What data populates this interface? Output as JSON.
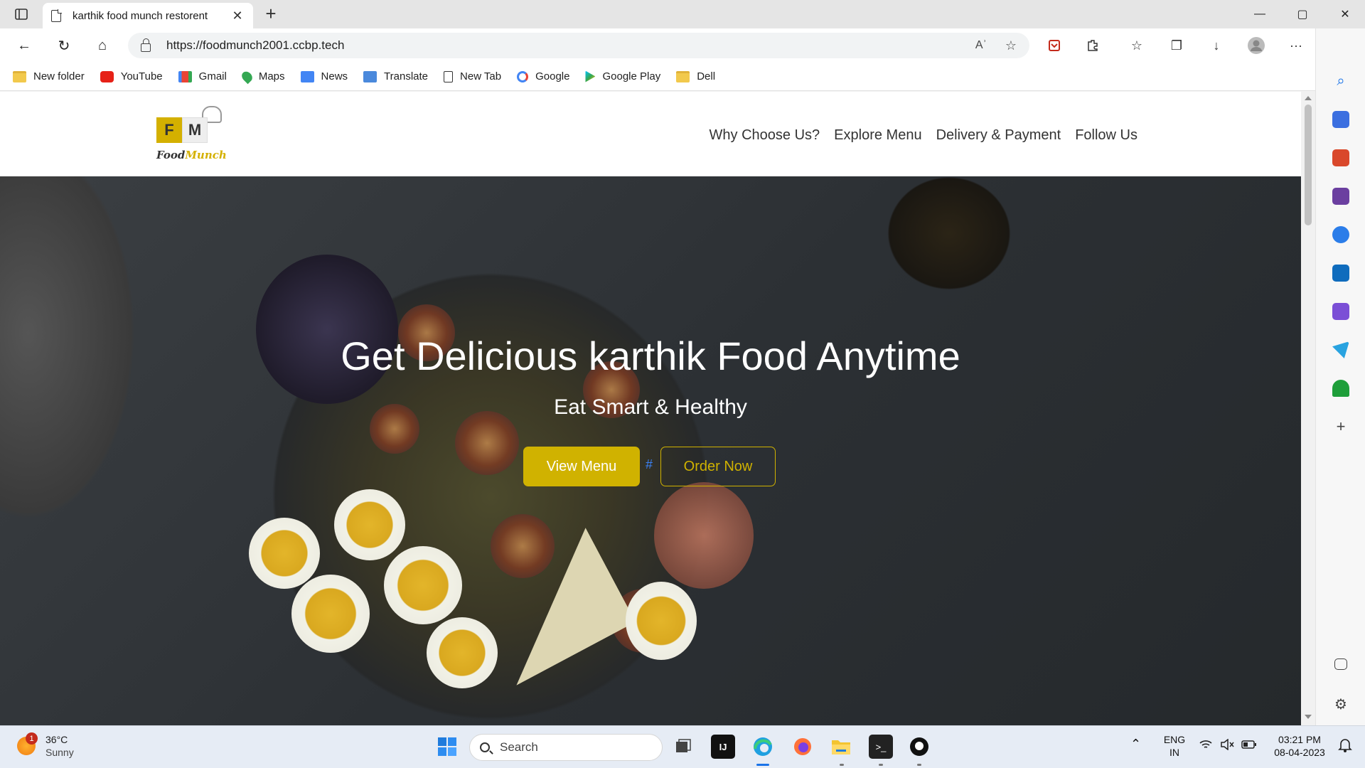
{
  "browser": {
    "tab": {
      "title": "karthik food munch restorent",
      "close": "✕"
    },
    "new_tab": "+",
    "window_controls": {
      "minimize": "—",
      "maximize": "▢",
      "close": "✕"
    },
    "address": {
      "url": "https://foodmunch2001.ccbp.tech",
      "read_aloud": "Aʾ",
      "favorite": "☆"
    },
    "nav": {
      "back": "←",
      "refresh": "↻",
      "home": "⌂"
    },
    "toolbar_icons": {
      "extensions": "⚙",
      "favorites": "☆",
      "collections": "❐",
      "downloads": "↓",
      "more": "···"
    },
    "bookmarks": [
      {
        "label": "New folder",
        "icon": "folder-icon"
      },
      {
        "label": "YouTube",
        "icon": "youtube-icon"
      },
      {
        "label": "Gmail",
        "icon": "gmail-icon"
      },
      {
        "label": "Maps",
        "icon": "maps-icon"
      },
      {
        "label": "News",
        "icon": "news-icon"
      },
      {
        "label": "Translate",
        "icon": "translate-icon"
      },
      {
        "label": "New Tab",
        "icon": "page-icon"
      },
      {
        "label": "Google",
        "icon": "google-icon"
      },
      {
        "label": "Google Play",
        "icon": "google-play-icon"
      },
      {
        "label": "Dell",
        "icon": "folder-icon"
      }
    ],
    "sidebar_icons": [
      "search-icon",
      "tag-icon",
      "toolbox-icon",
      "games-icon",
      "office-icon",
      "outlook-icon",
      "designer-icon",
      "send-icon",
      "tree-icon",
      "add-icon",
      "panel-icon",
      "settings-icon"
    ]
  },
  "site": {
    "logo": {
      "letter1": "F",
      "letter2": "M",
      "brand1": "Food",
      "brand2": "Munch"
    },
    "nav_links": [
      "Why Choose Us?",
      "Explore Menu",
      "Delivery & Payment",
      "Follow Us"
    ],
    "hero": {
      "title": "Get Delicious karthik Food Anytime",
      "subtitle": "Eat Smart & Healthy",
      "view_menu": "View Menu",
      "separator": "#",
      "order_now": "Order Now"
    }
  },
  "taskbar": {
    "weather": {
      "temp": "36°C",
      "condition": "Sunny",
      "badge": "1"
    },
    "search_placeholder": "Search",
    "lang": {
      "line1": "ENG",
      "line2": "IN"
    },
    "clock": {
      "time": "03:21 PM",
      "date": "08-04-2023"
    },
    "tray_chevron": "⌃"
  },
  "colors": {
    "accent": "#d0b200",
    "link_blue": "#3b82f6",
    "taskbar": "#e6ecf5"
  }
}
